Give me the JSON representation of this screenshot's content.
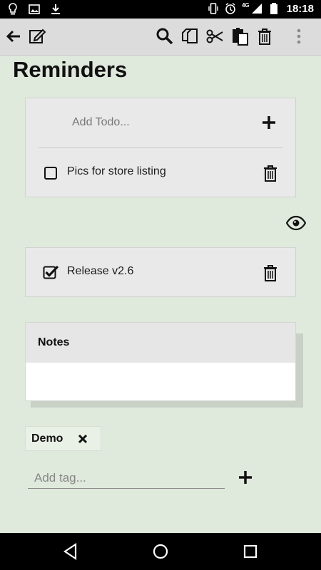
{
  "status_bar": {
    "time": "18:18",
    "network": "4G",
    "left_icons": [
      "lightbulb-icon",
      "image-icon",
      "download-icon"
    ],
    "right_icons": [
      "vibrate-icon",
      "alarm-icon",
      "signal-icon",
      "battery-icon"
    ]
  },
  "toolbar": {
    "icons": [
      "back-arrow-icon",
      "edit-icon",
      "search-icon",
      "copy-icon",
      "cut-icon",
      "paste-icon",
      "trash-icon",
      "more-vert-icon"
    ]
  },
  "page": {
    "title": "Reminders"
  },
  "todo": {
    "add_placeholder": "Add Todo...",
    "open_items": [
      {
        "label": "Pics for store listing",
        "checked": false
      }
    ],
    "done_items": [
      {
        "label": "Release v2.6",
        "checked": true
      }
    ]
  },
  "notes": {
    "title": "Notes",
    "body": ""
  },
  "tags": {
    "items": [
      {
        "label": "Demo"
      }
    ],
    "input_placeholder": "Add tag..."
  },
  "colors": {
    "background": "#dfe9dc",
    "toolbar": "#dcdcdc",
    "card": "#e9e9e9"
  }
}
